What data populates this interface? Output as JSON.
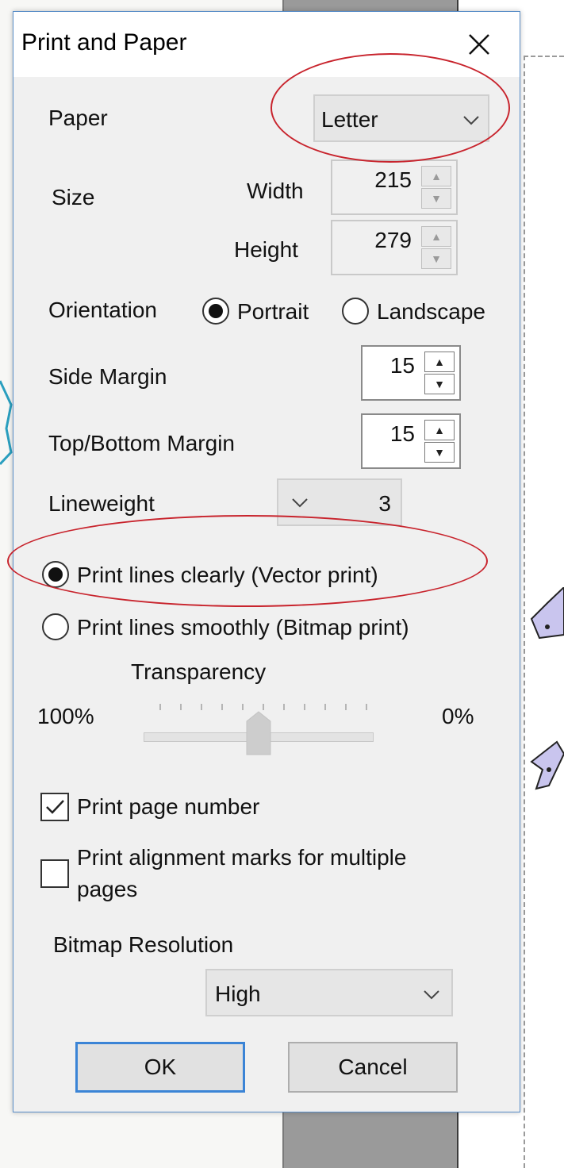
{
  "dialog": {
    "title": "Print and Paper",
    "close_icon": "close-icon"
  },
  "paper": {
    "label": "Paper",
    "selected": "Letter"
  },
  "size": {
    "label": "Size",
    "width_label": "Width",
    "width_value": "215",
    "height_label": "Height",
    "height_value": "279"
  },
  "orientation": {
    "label": "Orientation",
    "portrait_label": "Portrait",
    "landscape_label": "Landscape",
    "selected": "Portrait"
  },
  "side_margin": {
    "label": "Side Margin",
    "value": "15"
  },
  "top_bottom_margin": {
    "label": "Top/Bottom Margin",
    "value": "15"
  },
  "lineweight": {
    "label": "Lineweight",
    "value": "3"
  },
  "print_mode": {
    "vector_label": "Print lines clearly (Vector print)",
    "bitmap_label": "Print lines smoothly (Bitmap print)",
    "selected": "vector"
  },
  "transparency": {
    "label": "Transparency",
    "min_label": "100%",
    "max_label": "0%",
    "position_fraction": 0.5
  },
  "options": {
    "print_page_number_label": "Print page number",
    "print_page_number_checked": true,
    "alignment_marks_line1": "Print alignment marks for multiple",
    "alignment_marks_line2": "pages",
    "alignment_marks_checked": false
  },
  "bitmap_resolution": {
    "label": "Bitmap Resolution",
    "selected": "High"
  },
  "buttons": {
    "ok_label": "OK",
    "cancel_label": "Cancel"
  },
  "colors": {
    "annotation": "#c8242d",
    "default_button_border": "#3b84d6",
    "dialog_border": "#5a8ec8"
  }
}
